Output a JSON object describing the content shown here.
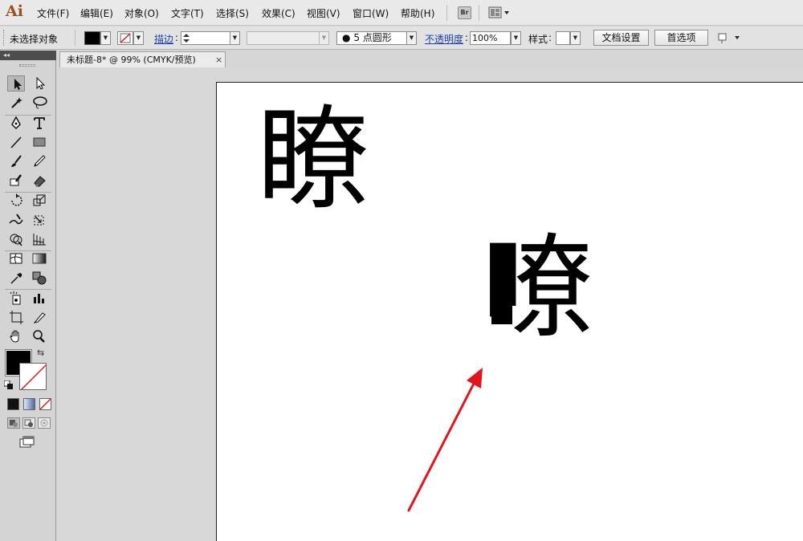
{
  "app": {
    "logo": "Ai"
  },
  "menu": [
    {
      "label": "文件(F)"
    },
    {
      "label": "编辑(E)"
    },
    {
      "label": "对象(O)"
    },
    {
      "label": "文字(T)"
    },
    {
      "label": "选择(S)"
    },
    {
      "label": "效果(C)"
    },
    {
      "label": "视图(V)"
    },
    {
      "label": "窗口(W)"
    },
    {
      "label": "帮助(H)"
    }
  ],
  "bridge_button": "Br",
  "control_bar": {
    "selection_status": "未选择对象",
    "stroke_label": "描边",
    "brush_size_label": "5 点圆形",
    "opacity_label": "不透明度",
    "opacity_value": "100%",
    "style_label": "样式",
    "doc_setup_button": "文档设置",
    "preferences_button": "首选项"
  },
  "document": {
    "tab_title": "未标题-8* @ 99% (CMYK/预览)",
    "close_glyph": "×"
  },
  "canvas": {
    "text_1": "瞭",
    "text_2": "嘹"
  },
  "colors": {
    "fill": "#000000",
    "stroke": "none",
    "arrow": "#e0161b"
  }
}
